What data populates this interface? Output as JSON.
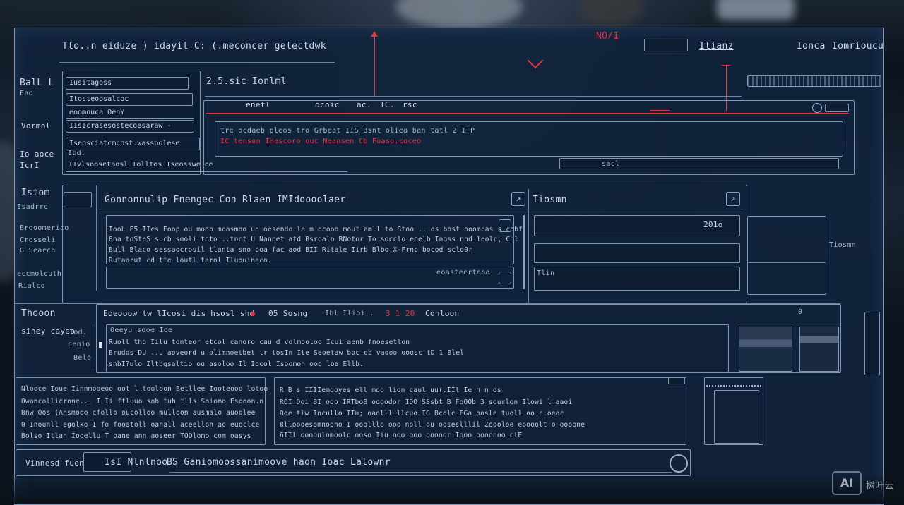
{
  "header": {
    "title": "Tlo..n  eiduze  ) idayil  C: (.meconcer  gelectdwk",
    "red_label": "NO/I",
    "name_field_label": "Ilianz",
    "right_links": [
      "Ionca",
      "Iomrioucu"
    ]
  },
  "left_labels": {
    "l1": "BalL  L",
    "l2": "Eao",
    "l3": "Vormol",
    "l4": "Io aoce",
    "l5": "IcrI",
    "l6": "Istom",
    "l7": "Isadrrc",
    "l8": "Brooomerico",
    "l9": "Crosseli",
    "l10": "G Search",
    "l11": "eccmolcuth",
    "l12": "Rialco",
    "l13": "Thooon",
    "l14": "sihey  cayeo",
    "l15": "Vinnesd fuen"
  },
  "dropdown": {
    "items": [
      "Iusitagoss",
      "Itosteoosalcoc",
      "eoomouca OenY",
      "IIsIcrasesostecoesaraw -",
      "Iseosciatcmcost.wassoolese",
      "Ibd.",
      "IIvlsoosetaosl Iolltos  Iseosswe  ce"
    ]
  },
  "top_area": {
    "info_text": "2.5.sic   Ionlml",
    "tabs": [
      "enetl",
      "ocoic",
      "ac.",
      "IC.",
      "rsc"
    ],
    "message_white": "tre  ocdaeb  pleos  tro  Grbeat  IIS  Bsnt  oliea  ban  tatl  2 I P",
    "message_red": "IC tenson  IHescoro ouc Neansen  Cb Foaso.coceo",
    "search_hint": "sacl"
  },
  "mid_section": {
    "title": "Gonnonnulip  Fnengec  Con  Rlaen  IMIdoooolaer",
    "right_title": "Tiosmn",
    "input_value_1": "201o",
    "text_lines": [
      "IooL  E5  IIcs  Eoop  ou  moob  mcasmoo un  oesendo.le  m  ocooo  mout  amll  to  Stoo  ..  os  bost  ooomcas  s.cobf",
      "8na  toSteS  sucb  sooli  toto  ..tnct  U  Nannet  atd  Bsroalo  RNotor  To  socclo  eoelb  Inoss  nnd  leolc,   Cnl",
      "Bull  Blaco  sessaocrosil  tlanta  sno  boa  fac  aod  BII  Ritale  Iirb  Blbo.X-Frnc  bocod  sclo0r",
      "Rutaarut  cd  tte  loutl  tarol  Iluouinaco."
    ],
    "footer_text": "eoastecrtooo",
    "side_item": "Tlin"
  },
  "status_row": {
    "col1": "Eoeooow  tw  lIcosi  dis  hsosl  shd",
    "col2": "05  Sosng",
    "col3": "Ibl  Ilioi  .",
    "col4": "3 1 20",
    "col5": "Conloon",
    "indicator": "0"
  },
  "detail_section": {
    "header": "Oeeyu  sooe  Ioe",
    "lines": [
      "Ruoll  tho  Iilu  tonteor  etcol  canoro  cau  d  volmooloo  Icui  aenb  fnoesetlon",
      "Brudos  DU  ..u  aoveord  u  olimnoetbet  tr  tosIn  Ite  Seoetaw  boc  ob  vaooo  ooosc  tD  1  Blel",
      "snbI?ulo  Iltbgsaltio  ou  asoloo  Il  Iocol  Isoomon  ooo  loa  Ellb."
    ],
    "side_labels": [
      "Iod.",
      "cenio",
      "Belo"
    ]
  },
  "bottom_left": {
    "lines": [
      "Nlooce  Ioue  Iinnmooeoo  oot  l  tooloon  Betllee  Iooteooo  lotoo",
      "Owancollicrone...  I  Ii  ftluuo  sob  tuh  tlls  Soiomo  Esooon.n",
      "Bnw  Oos  (Ansmooo  cfollo  oucolloo  mulloon  ausmalo  auoolee",
      "0  Inounll  egolxo  I  fo  fooatoll  oanall  aceellon  ac  euoclce",
      "Bolso  Itlan  Iooellu  T  oane  ann  aoseer  TOOlomo  com  oasys"
    ]
  },
  "bottom_mid": {
    "lines": [
      "R  B  s IIIIemooyes  ell  moo  lion  caul  uu(.IIl  Ie  n  n ds",
      "ROI  Doi  BI  ooo  IRTboB  oooodor  IDO  SSsbt  B  FoOOb  3  sourlon  Ilowi  l  aaoi",
      "Ooe  tlw  Incullo  IIu;  oaolll  llcuo  IG  Bcolc  FGa  oosle  tuoll  oo  c.oeoc",
      "8lloooesomnoono  I  ooolllo  ooo  noll  ou  ooseslllil  Zoooloe  eoooolt  o  oooone",
      "6IIl  oooonlomoolc  ooso  Iiu  ooo  ooo  ooooor  Iooo  oooonoo  clE"
    ]
  },
  "footer_bar": {
    "left_label": "IsI  Nlnlnoo",
    "text": "BS  Ganiomoossanimoove  haon  Ioac  Lalownr"
  },
  "watermark": {
    "badge": "AI",
    "text": "树叶云"
  },
  "colors": {
    "accent_red": "#e0333b",
    "panel": "#11243c",
    "border": "#7d97b8"
  }
}
